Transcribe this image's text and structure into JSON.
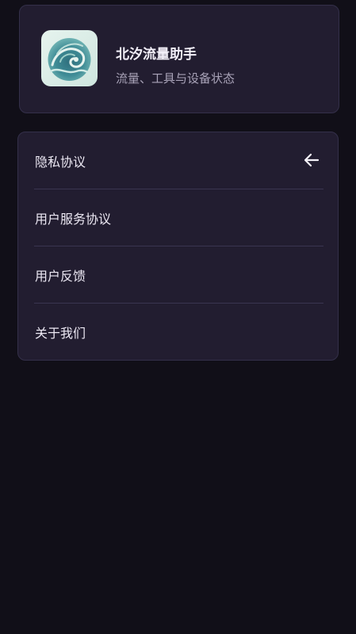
{
  "header": {
    "app_name": "北汐流量助手",
    "app_desc": "流量、工具与设备状态",
    "icon": "wave-logo-icon"
  },
  "menu": {
    "items": [
      {
        "label": "隐私协议",
        "icon": "arrow-left-icon"
      },
      {
        "label": "用户服务协议"
      },
      {
        "label": "用户反馈"
      },
      {
        "label": "关于我们"
      }
    ]
  },
  "colors": {
    "background": "#110f18",
    "card": "#221d30",
    "card_border": "#34304a",
    "text_primary": "#ece8f3",
    "text_secondary": "#a9a3b8"
  }
}
